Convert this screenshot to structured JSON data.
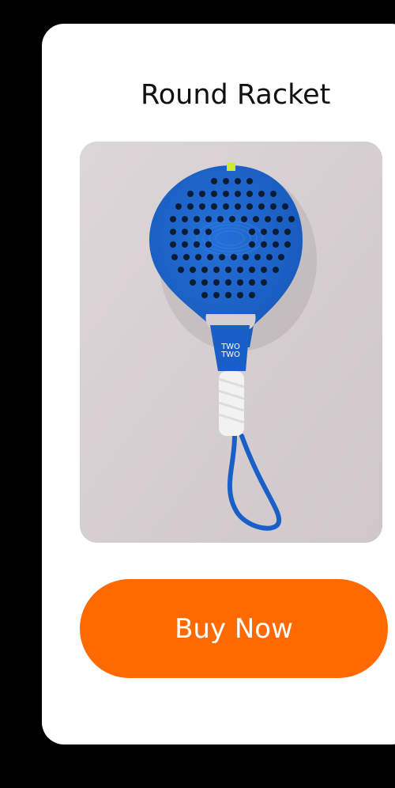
{
  "product": {
    "title": "Round Racket",
    "image_alt": "Blue round padel racket with white grip and wrist strap",
    "brand_mark_line1": "TWO",
    "brand_mark_line2": "TWO"
  },
  "actions": {
    "buy_label": "Buy Now"
  },
  "colors": {
    "page_background": "#000000",
    "card_background": "#ffffff",
    "button_background": "#ff6a00",
    "button_text": "#ffffff",
    "racket_blue": "#1a5fc7",
    "image_background": "#d9d2d4"
  }
}
